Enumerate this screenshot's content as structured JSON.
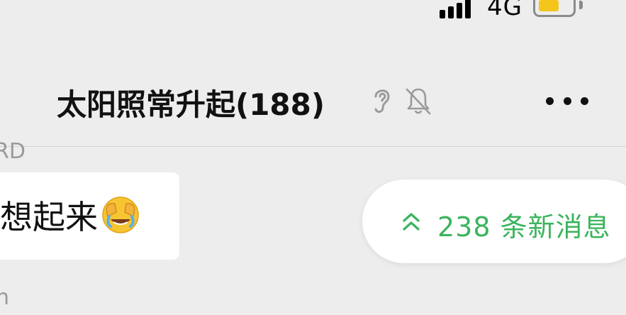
{
  "status_bar": {
    "network": "4G",
    "battery_level": 0.6,
    "battery_color": "#f4c61d"
  },
  "header": {
    "title": "太阳照常升起(188)",
    "icons": [
      "ear-icon",
      "bell-muted-icon",
      "more-icon"
    ]
  },
  "messages": [
    {
      "sender": "RD",
      "text": "想起来",
      "emoji": "crying-laughing-face"
    },
    {
      "sender": "n"
    }
  ],
  "new_messages": {
    "label": "238 条新消息",
    "color": "#3bb45c",
    "icon": "double-chevron-up-icon"
  }
}
